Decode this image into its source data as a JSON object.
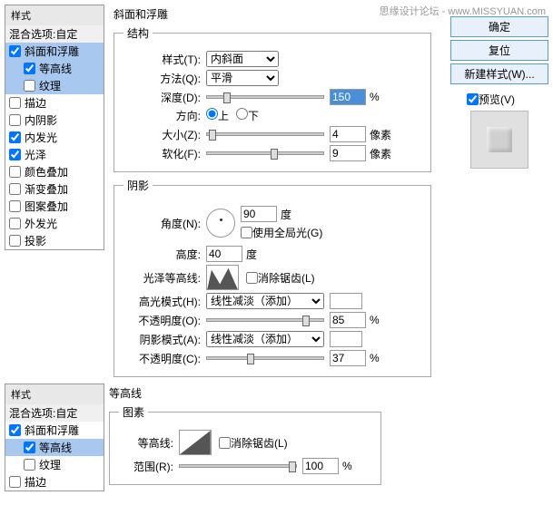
{
  "watermark": "思缘设计论坛 - www.MISSYUAN.com",
  "styles_header": "样式",
  "blend_options": "混合选项:自定",
  "effects": {
    "bevel": "斜面和浮雕",
    "contour": "等高线",
    "texture": "纹理",
    "stroke": "描边",
    "inner_shadow": "内阴影",
    "inner_glow": "内发光",
    "satin": "光泽",
    "color_overlay": "颜色叠加",
    "gradient_overlay": "渐变叠加",
    "pattern_overlay": "图案叠加",
    "outer_glow": "外发光",
    "drop_shadow": "投影"
  },
  "main_title": "斜面和浮雕",
  "structure": {
    "title": "结构",
    "style_lbl": "样式(T):",
    "style_val": "内斜面",
    "method_lbl": "方法(Q):",
    "method_val": "平滑",
    "depth_lbl": "深度(D):",
    "depth_val": "150",
    "pct": "%",
    "direction_lbl": "方向:",
    "up": "上",
    "down": "下",
    "size_lbl": "大小(Z):",
    "size_val": "4",
    "px": "像素",
    "soften_lbl": "软化(F):",
    "soften_val": "9"
  },
  "shading": {
    "title": "阴影",
    "angle_lbl": "角度(N):",
    "angle_val": "90",
    "deg": "度",
    "global_lbl": "使用全局光(G)",
    "altitude_lbl": "高度:",
    "altitude_val": "40",
    "gloss_lbl": "光泽等高线:",
    "antialias_lbl": "消除锯齿(L)",
    "highlight_mode_lbl": "高光模式(H):",
    "highlight_mode_val": "线性减淡（添加）",
    "opacity_lbl": "不透明度(O):",
    "hi_opacity_val": "85",
    "shadow_mode_lbl": "阴影模式(A):",
    "shadow_mode_val": "线性减淡（添加）",
    "opacity2_lbl": "不透明度(C):",
    "sh_opacity_val": "37"
  },
  "contour_panel": {
    "title": "等高线",
    "elements": "图素",
    "contour_lbl": "等高线:",
    "antialias_lbl": "消除锯齿(L)",
    "range_lbl": "范围(R):",
    "range_val": "100",
    "pct": "%"
  },
  "right": {
    "ok": "确定",
    "reset": "复位",
    "new_style": "新建样式(W)...",
    "preview": "预览(V)"
  }
}
